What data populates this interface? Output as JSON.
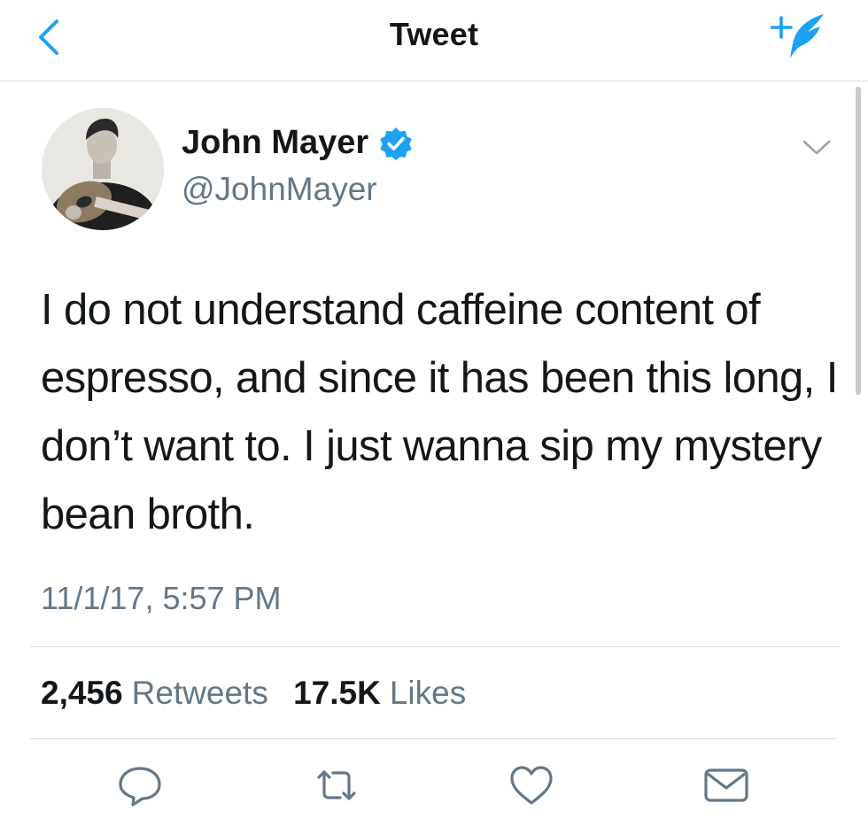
{
  "nav": {
    "title": "Tweet",
    "back_icon": "chevron-left-icon",
    "compose_icon": "compose-tweet-icon",
    "accent_color": "#1da1f2"
  },
  "tweet": {
    "author": {
      "name": "John Mayer",
      "handle": "@JohnMayer",
      "verified": true,
      "avatar_icon": "avatar-photo"
    },
    "text": "I do not understand caffeine content of espresso, and since it has been this long, I don’t want to. I just wanna sip my mystery bean broth.",
    "timestamp": "11/1/17, 5:57 PM",
    "stats": {
      "retweets_count": "2,456",
      "retweets_label": "Retweets",
      "likes_count": "17.5K",
      "likes_label": "Likes"
    },
    "actions": [
      "reply-icon",
      "retweet-icon",
      "like-icon",
      "share-icon"
    ]
  },
  "colors": {
    "text_primary": "#14171a",
    "text_secondary": "#657786",
    "divider": "#d8dde1",
    "icon_gray": "#657786"
  }
}
